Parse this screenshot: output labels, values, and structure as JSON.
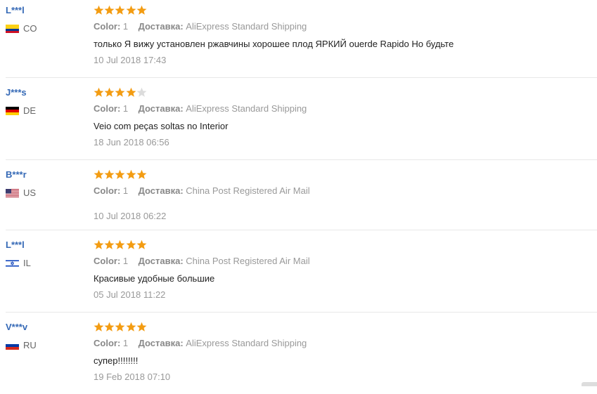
{
  "labels": {
    "color": "Color:",
    "delivery": "Доставка:"
  },
  "reviews": [
    {
      "user": "L***l",
      "country": "CO",
      "rating": 5,
      "color": "1",
      "delivery": "AliExpress Standard Shipping",
      "text": "только Я вижу установлен ржавчины хорошее плод ЯРКИЙ ouerde Rapido Но будьте",
      "date": "10 Jul 2018 17:43"
    },
    {
      "user": "J***s",
      "country": "DE",
      "rating": 4,
      "color": "1",
      "delivery": "AliExpress Standard Shipping",
      "text": "Veio com peças soltas no Interior",
      "date": "18 Jun 2018 06:56"
    },
    {
      "user": "B***r",
      "country": "US",
      "rating": 5,
      "color": "1",
      "delivery": "China Post Registered Air Mail",
      "text": "",
      "date": "10 Jul 2018 06:22"
    },
    {
      "user": "L***l",
      "country": "IL",
      "rating": 5,
      "color": "1",
      "delivery": "China Post Registered Air Mail",
      "text": "Красивые удобные большие",
      "date": "05 Jul 2018 11:22"
    },
    {
      "user": "V***v",
      "country": "RU",
      "rating": 5,
      "color": "1",
      "delivery": "AliExpress Standard Shipping",
      "text": "супер!!!!!!!!",
      "date": "19 Feb 2018 07:10"
    }
  ],
  "colors": {
    "user": "#3569b6",
    "star_filled": "#f39c12",
    "star_empty": "#dcdcdc"
  },
  "icons": {
    "star": "star-icon",
    "flag": "flag-icon"
  }
}
